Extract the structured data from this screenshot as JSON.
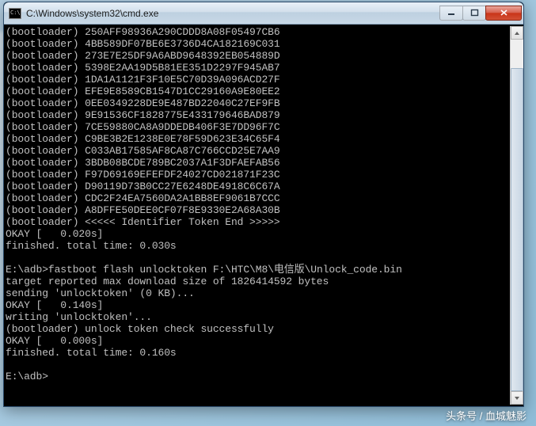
{
  "window": {
    "title": "C:\\Windows\\system32\\cmd.exe"
  },
  "bootloader_lines": [
    "250AFF98936A290CDDD8A08F05497CB6",
    "4BB589DF07BE6E3736D4CA182169C031",
    "273E7E25DF9A6ABD9648392EB054889D",
    "5398E2AA19D5B81EE351D2297F945AB7",
    "1DA1A1121F3F10E5C70D39A096ACD27F",
    "EFE9E8589CB1547D1CC29160A9E80EE2",
    "0EE0349228DE9E487BD22040C27EF9FB",
    "9E91536CF1828775E433179646BAD879",
    "7CE59880CA8A9DDEDB406F3E7DD96F7C",
    "C9BE3B2E1238E0E78F59D623E34C65F4",
    "C033AB17585AF8CA87C766CCD25E7AA9",
    "3BDB08BCDE789BC2037A1F3DFAEFAB56",
    "F97D69169EFEFDF24027CD021871F23C",
    "D90119D73B0CC27E6248DE4918C6C67A",
    "CDC2F24EA7560DA2A1BB8EF9061B7CCC",
    "A8DFFE50DEE0CF07F8E9330E2A68A30B"
  ],
  "identifier_end": "<<<<< Identifier Token End >>>>>",
  "okay1_time": "0.020s",
  "finished1": "finished. total time: 0.030s",
  "prompt1_path": "E:\\adb>",
  "command": "fastboot flash unlocktoken F:\\HTC\\M8\\电信版\\Unlock_code.bin",
  "target_line": "target reported max download size of 1826414592 bytes",
  "sending_line": "sending 'unlocktoken' (0 KB)...",
  "okay2_time": "0.140s",
  "writing_line": "writing 'unlocktoken'...",
  "success_line": "(bootloader) unlock token check successfully",
  "okay3_time": "0.000s",
  "finished2": "finished. total time: 0.160s",
  "prompt2": "E:\\adb>",
  "watermark": "头条号 / 血城魅影"
}
